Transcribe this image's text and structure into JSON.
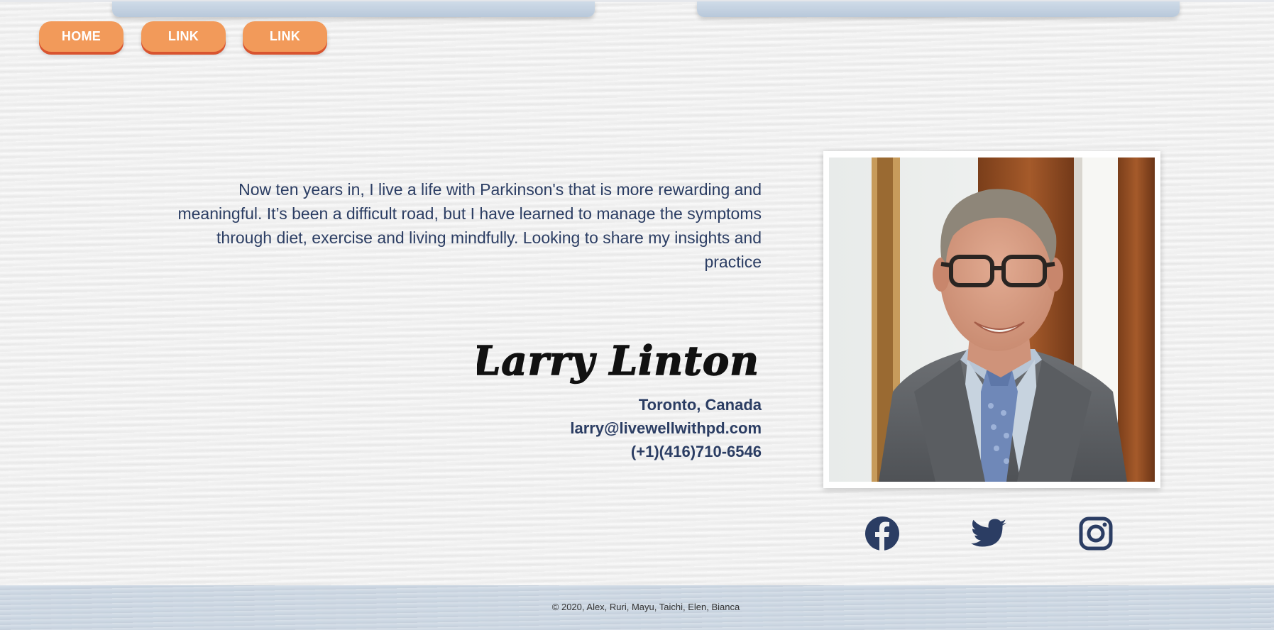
{
  "nav": {
    "items": [
      {
        "label": "HOME"
      },
      {
        "label": "LINK"
      },
      {
        "label": "LINK"
      }
    ]
  },
  "profile": {
    "quote": "Now ten years in, I live a life with Parkinson's that is more rewarding and meaningful. It’s been a difficult road, but I have learned to manage the symptoms through diet, exercise and living mindfully. Looking to share my insights and practice",
    "signature": "-Larry Linton",
    "location": "Toronto, Canada",
    "email": "larry@livewellwithpd.com",
    "phone": "(+1)(416)710-6546"
  },
  "social": [
    {
      "icon": "facebook-icon"
    },
    {
      "icon": "twitter-icon"
    },
    {
      "icon": "instagram-icon"
    }
  ],
  "footer": {
    "copyright": "© 2020, Alex, Ruri, Mayu, Taichi, Elen, Bianca"
  },
  "colors": {
    "accent": "#f29a5a",
    "accent_shadow": "#d9542f",
    "text": "#2b3d63",
    "footer_bg": "#cbd6e2"
  }
}
